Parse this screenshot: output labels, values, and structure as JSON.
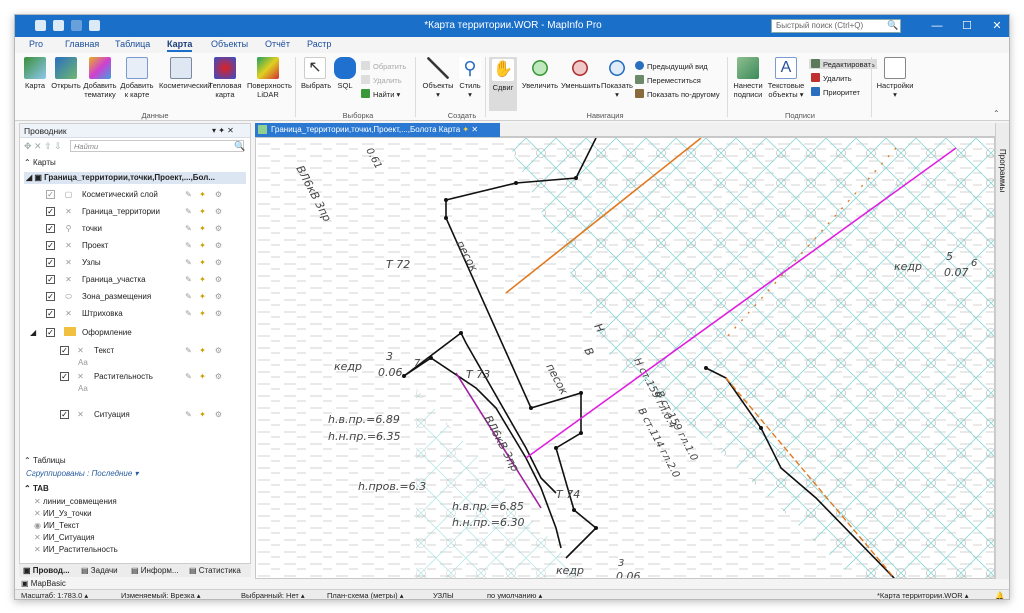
{
  "window": {
    "title": "*Карта территории.WOR - MapInfo Pro",
    "search_placeholder": "Быстрый поиск (Ctrl+Q)",
    "minimize": "—",
    "maximize": "☐",
    "close": "✕"
  },
  "ribbon_tabs": [
    "Pro",
    "Главная",
    "Таблица",
    "Карта",
    "Объекты",
    "Отчёт",
    "Растр"
  ],
  "ribbon": {
    "karta": "Карта",
    "otkryt": "Открыть",
    "dobavit_tematiku": "Добавить тематику",
    "dobavit_k_karte": "Добавить к карте",
    "kosmeticheskiy": "Косметический",
    "teplovaya_karta": "Тепловая карта",
    "poverhnost_lidar": "Поверхность LiDAR",
    "group_dannye": "Данные",
    "vybrat": "Выбрать",
    "sql": "SQL",
    "obratit": "Обратить",
    "udalit_sel": "Удалить",
    "naiti": "Найти",
    "group_vyborka": "Выборка",
    "obekty": "Объекты",
    "stil": "Стиль",
    "group_sozdat": "Создать",
    "sdvig": "Сдвиг",
    "uvelichit": "Увеличить",
    "umenshit": "Уменьшить",
    "pokazat": "Показать",
    "predyduschiy_vid": "Предыдущий вид",
    "peremestitsya": "Переместиться",
    "pokazat_po_drugomu": "Показать по-другому",
    "group_navigaciya": "Навигация",
    "nanesti_podpisi": "Нанести подписи",
    "tekstovye_obekty": "Текстовые объекты",
    "redaktirovat": "Редактировать",
    "udalit": "Удалить",
    "prioritet": "Приоритет",
    "group_podpisi": "Подписи",
    "nastroyki": "Настройки"
  },
  "explorer": {
    "title": "Проводник",
    "find_placeholder": "Найти",
    "maps_header": "Карты",
    "map_name": "Граница_территории,точки,Проект,...,Бол...",
    "layers": [
      {
        "name": "Косметический слой"
      },
      {
        "name": "Граница_территории"
      },
      {
        "name": "точки"
      },
      {
        "name": "Проект"
      },
      {
        "name": "Узлы"
      },
      {
        "name": "Граница_участка"
      },
      {
        "name": "Зона_размещения"
      },
      {
        "name": "Штриховка"
      }
    ],
    "group_name": "Оформление",
    "group_layers": [
      {
        "name": "Текст",
        "sub": "Aa"
      },
      {
        "name": "Растительность",
        "sub": "Aa"
      },
      {
        "name": "Ситуация",
        "sub": ""
      }
    ],
    "tables_header": "Таблицы",
    "grouped_by": "Сгруппированы : Последние",
    "tab_header": "TAB",
    "tables": [
      "линии_совмещения",
      "ИИ_Уз_точки",
      "ИИ_Текст",
      "ИИ_Ситуация",
      "ИИ_Растительность"
    ]
  },
  "bottom_tabs": [
    "Провод...",
    "Задачи",
    "Информ...",
    "Статистика"
  ],
  "mapbasic": "MapBasic",
  "map_tab": "Граница_территории,точки,Проект,...,Болота Карта",
  "right_panel": "Программы",
  "map_labels": {
    "vl1": "ВЛ6кВ 3пр",
    "t72": "Т 72",
    "pesok1": "песок",
    "t73": "Т 73",
    "pesok2": "песок",
    "vl2": "ВЛ6кВ 3пр",
    "t74": "Т 74",
    "n": "Н",
    "v": "В",
    "n_st": "Н ст.159 гл.0.4",
    "v_st1": "В ст.159 гл.1.0",
    "v_st2": "В ст.114 гл.2.0",
    "kedr_left": "кедр",
    "kedr_left_num": "3",
    "kedr_left_den": "0.06",
    "kedr_left_7": "7",
    "kedr_right": "кедр",
    "kedr_right_num": "5",
    "kedr_right_den": "0.07",
    "kedr_right_6": "6",
    "kedr_bottom": "кедр",
    "kedr_bottom_num": "3",
    "kedr_bottom_den": "0.06",
    "hvpr1": "h.в.пр.=6.89",
    "hnpr1": "h.н.пр.=6.35",
    "hprov": "h.пров.=6.3",
    "hvpr2": "h.в.пр.=6.85",
    "hnpr2": "h.н.пр.=6.30",
    "top_num": "0.61"
  },
  "status": {
    "scale": "Масштаб: 1:783.0",
    "editable": "Изменяемый: Врезка",
    "selected": "Выбранный: Нет",
    "projection": "План-схема (метры)",
    "uzly": "УЗЛЫ",
    "default": "по умолчанию",
    "workspace": "*Карта территории.WOR"
  },
  "colors": {
    "titlebar": "#1a6fc9",
    "accent": "#2a78d2",
    "hatch": "#7fcfcf",
    "magenta": "#e020e0",
    "orange": "#e07a20"
  }
}
